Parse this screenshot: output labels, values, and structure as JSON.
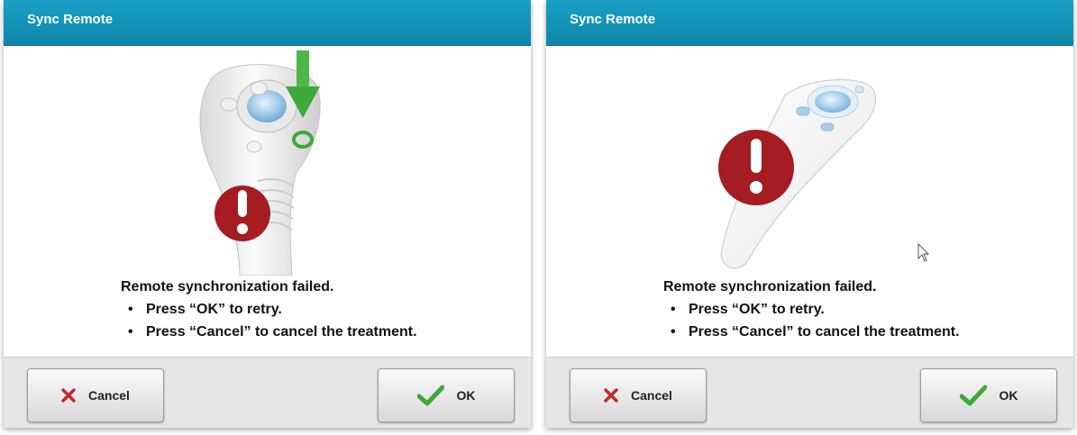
{
  "dialogs": [
    {
      "title": "Sync Remote",
      "message": "Remote synchronization failed.",
      "bullets": [
        "Press “OK” to retry.",
        "Press “Cancel” to cancel the treatment."
      ],
      "cancel_label": "Cancel",
      "ok_label": "OK"
    },
    {
      "title": "Sync Remote",
      "message": "Remote synchronization failed.",
      "bullets": [
        "Press “OK” to retry.",
        "Press “Cancel” to cancel the treatment."
      ],
      "cancel_label": "Cancel",
      "ok_label": "OK"
    }
  ],
  "colors": {
    "titlebar": "#1295bd",
    "alert_red": "#a51c22",
    "ok_green": "#3fa93a",
    "cancel_red": "#c0262c",
    "footer": "#e6e6e6"
  },
  "icons": {
    "alert": "exclamation-circle-icon",
    "arrow": "down-arrow-icon",
    "cancel": "x-icon",
    "ok": "checkmark-icon",
    "cursor": "mouse-pointer-icon"
  }
}
